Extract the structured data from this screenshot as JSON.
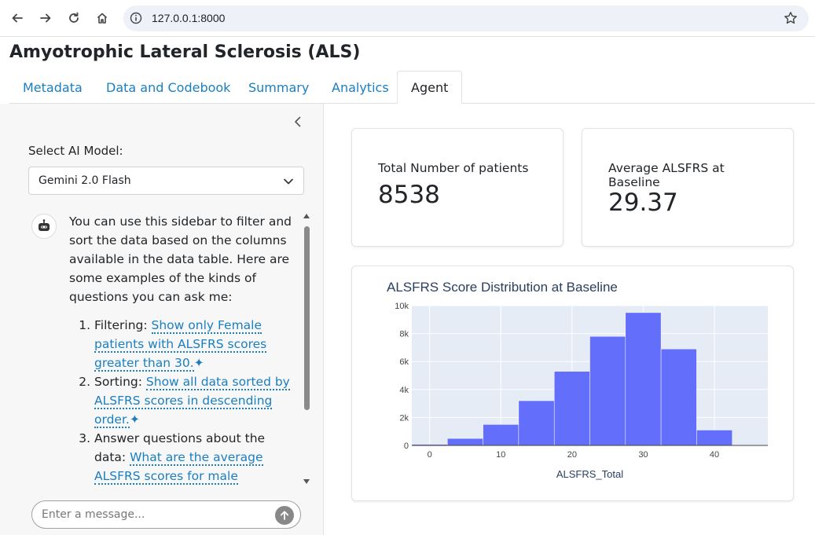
{
  "browser": {
    "url": "127.0.0.1:8000"
  },
  "page": {
    "title": "Amyotrophic Lateral Sclerosis (ALS)"
  },
  "tabs": [
    {
      "label": "Metadata"
    },
    {
      "label": "Data and Codebook"
    },
    {
      "label": "Summary"
    },
    {
      "label": "Analytics"
    },
    {
      "label": "Agent"
    }
  ],
  "sidebar": {
    "model_label": "Select AI Model:",
    "model_selected": "Gemini 2.0 Flash",
    "message_intro": "You can use this sidebar to filter and sort the data based on the columns available in the data table. Here are some examples of the kinds of questions you can ask me:",
    "items": [
      {
        "prefix": "Filtering:",
        "suggestion": "Show only Female patients with ALSFRS scores greater than 30."
      },
      {
        "prefix": "Sorting:",
        "suggestion": "Show all data sorted by ALSFRS scores in descending order."
      },
      {
        "prefix": "Answer questions about the data:",
        "suggestion": "What are the average ALSFRS scores for male patients?"
      }
    ],
    "spark": "✦",
    "input_placeholder": "Enter a message..."
  },
  "value_boxes": [
    {
      "label": "Total Number of patients",
      "value": "8538"
    },
    {
      "label": "Average ALSFRS at Baseline",
      "value": "29.37"
    }
  ],
  "chart_data": {
    "type": "bar",
    "title": "ALSFRS Score Distribution at Baseline",
    "xlabel": "ALSFRS_Total",
    "ylabel": "",
    "bins": [
      {
        "x0": -2.5,
        "x1": 2.5,
        "value": 80
      },
      {
        "x0": 2.5,
        "x1": 7.5,
        "value": 500
      },
      {
        "x0": 7.5,
        "x1": 12.5,
        "value": 1500
      },
      {
        "x0": 12.5,
        "x1": 17.5,
        "value": 3200
      },
      {
        "x0": 17.5,
        "x1": 22.5,
        "value": 5300
      },
      {
        "x0": 22.5,
        "x1": 27.5,
        "value": 7800
      },
      {
        "x0": 27.5,
        "x1": 32.5,
        "value": 9500
      },
      {
        "x0": 32.5,
        "x1": 37.5,
        "value": 6900
      },
      {
        "x0": 37.5,
        "x1": 42.5,
        "value": 1100
      }
    ],
    "xlim": [
      -2.5,
      47.5
    ],
    "ylim": [
      0,
      10000
    ],
    "x_ticks": [
      0,
      10,
      20,
      30,
      40
    ],
    "y_ticks": [
      0,
      2000,
      4000,
      6000,
      8000,
      10000
    ],
    "y_tick_labels": [
      "0",
      "2k",
      "4k",
      "6k",
      "8k",
      "10k"
    ],
    "bar_color": "#636efa",
    "plot_bg": "#e5ecf6",
    "grid": true
  }
}
